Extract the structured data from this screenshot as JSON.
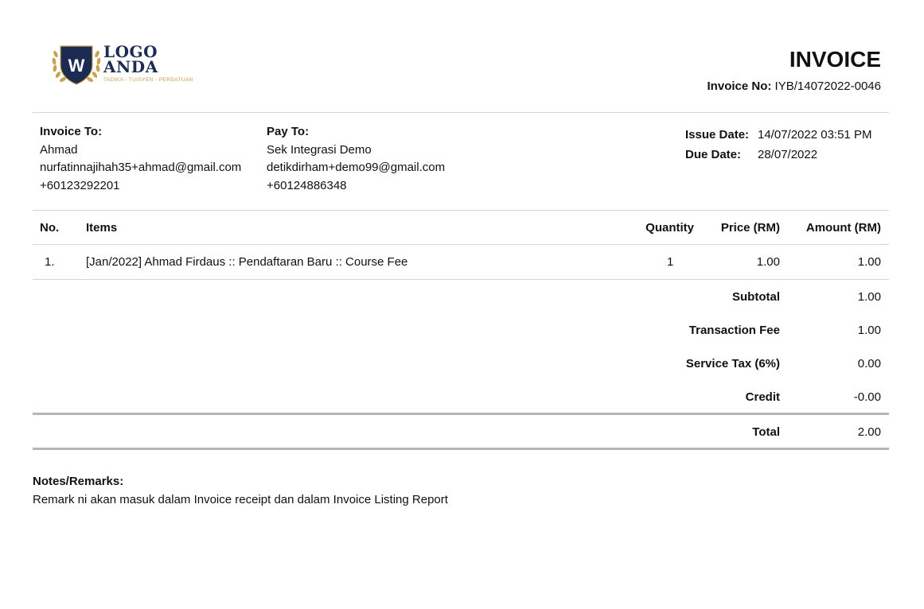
{
  "logo": {
    "line1": "LOGO",
    "line2": "ANDA",
    "tagline": "TADIKA - TUISYEN - PERSATUAN",
    "monogram": "W",
    "colors": {
      "shield": "#1b2b52",
      "gold": "#c9a14a"
    }
  },
  "header": {
    "title": "INVOICE",
    "invoice_no_label": "Invoice No:",
    "invoice_no": "IYB/14072022-0046"
  },
  "invoice_to": {
    "label": "Invoice To:",
    "name": "Ahmad",
    "email": "nurfatinnajihah35+ahmad@gmail.com",
    "phone": "+60123292201"
  },
  "pay_to": {
    "label": "Pay To:",
    "name": "Sek Integrasi Demo",
    "email": "detikdirham+demo99@gmail.com",
    "phone": "+60124886348"
  },
  "dates": {
    "issue_label": "Issue Date:",
    "issue_value": "14/07/2022 03:51 PM",
    "due_label": "Due Date:",
    "due_value": "28/07/2022"
  },
  "table": {
    "headers": {
      "no": "No.",
      "items": "Items",
      "quantity": "Quantity",
      "price": "Price (RM)",
      "amount": "Amount (RM)"
    },
    "rows": [
      {
        "no": "1.",
        "item": "[Jan/2022] Ahmad Firdaus :: Pendaftaran Baru :: Course Fee",
        "quantity": "1",
        "price": "1.00",
        "amount": "1.00"
      }
    ]
  },
  "summary": {
    "subtotal_label": "Subtotal",
    "subtotal": "1.00",
    "fee_label": "Transaction Fee",
    "fee": "1.00",
    "tax_label": "Service Tax (6%)",
    "tax": "0.00",
    "credit_label": "Credit",
    "credit": "-0.00",
    "total_label": "Total",
    "total": "2.00"
  },
  "notes": {
    "label": "Notes/Remarks:",
    "text": "Remark ni akan masuk dalam Invoice receipt dan dalam Invoice Listing Report"
  }
}
